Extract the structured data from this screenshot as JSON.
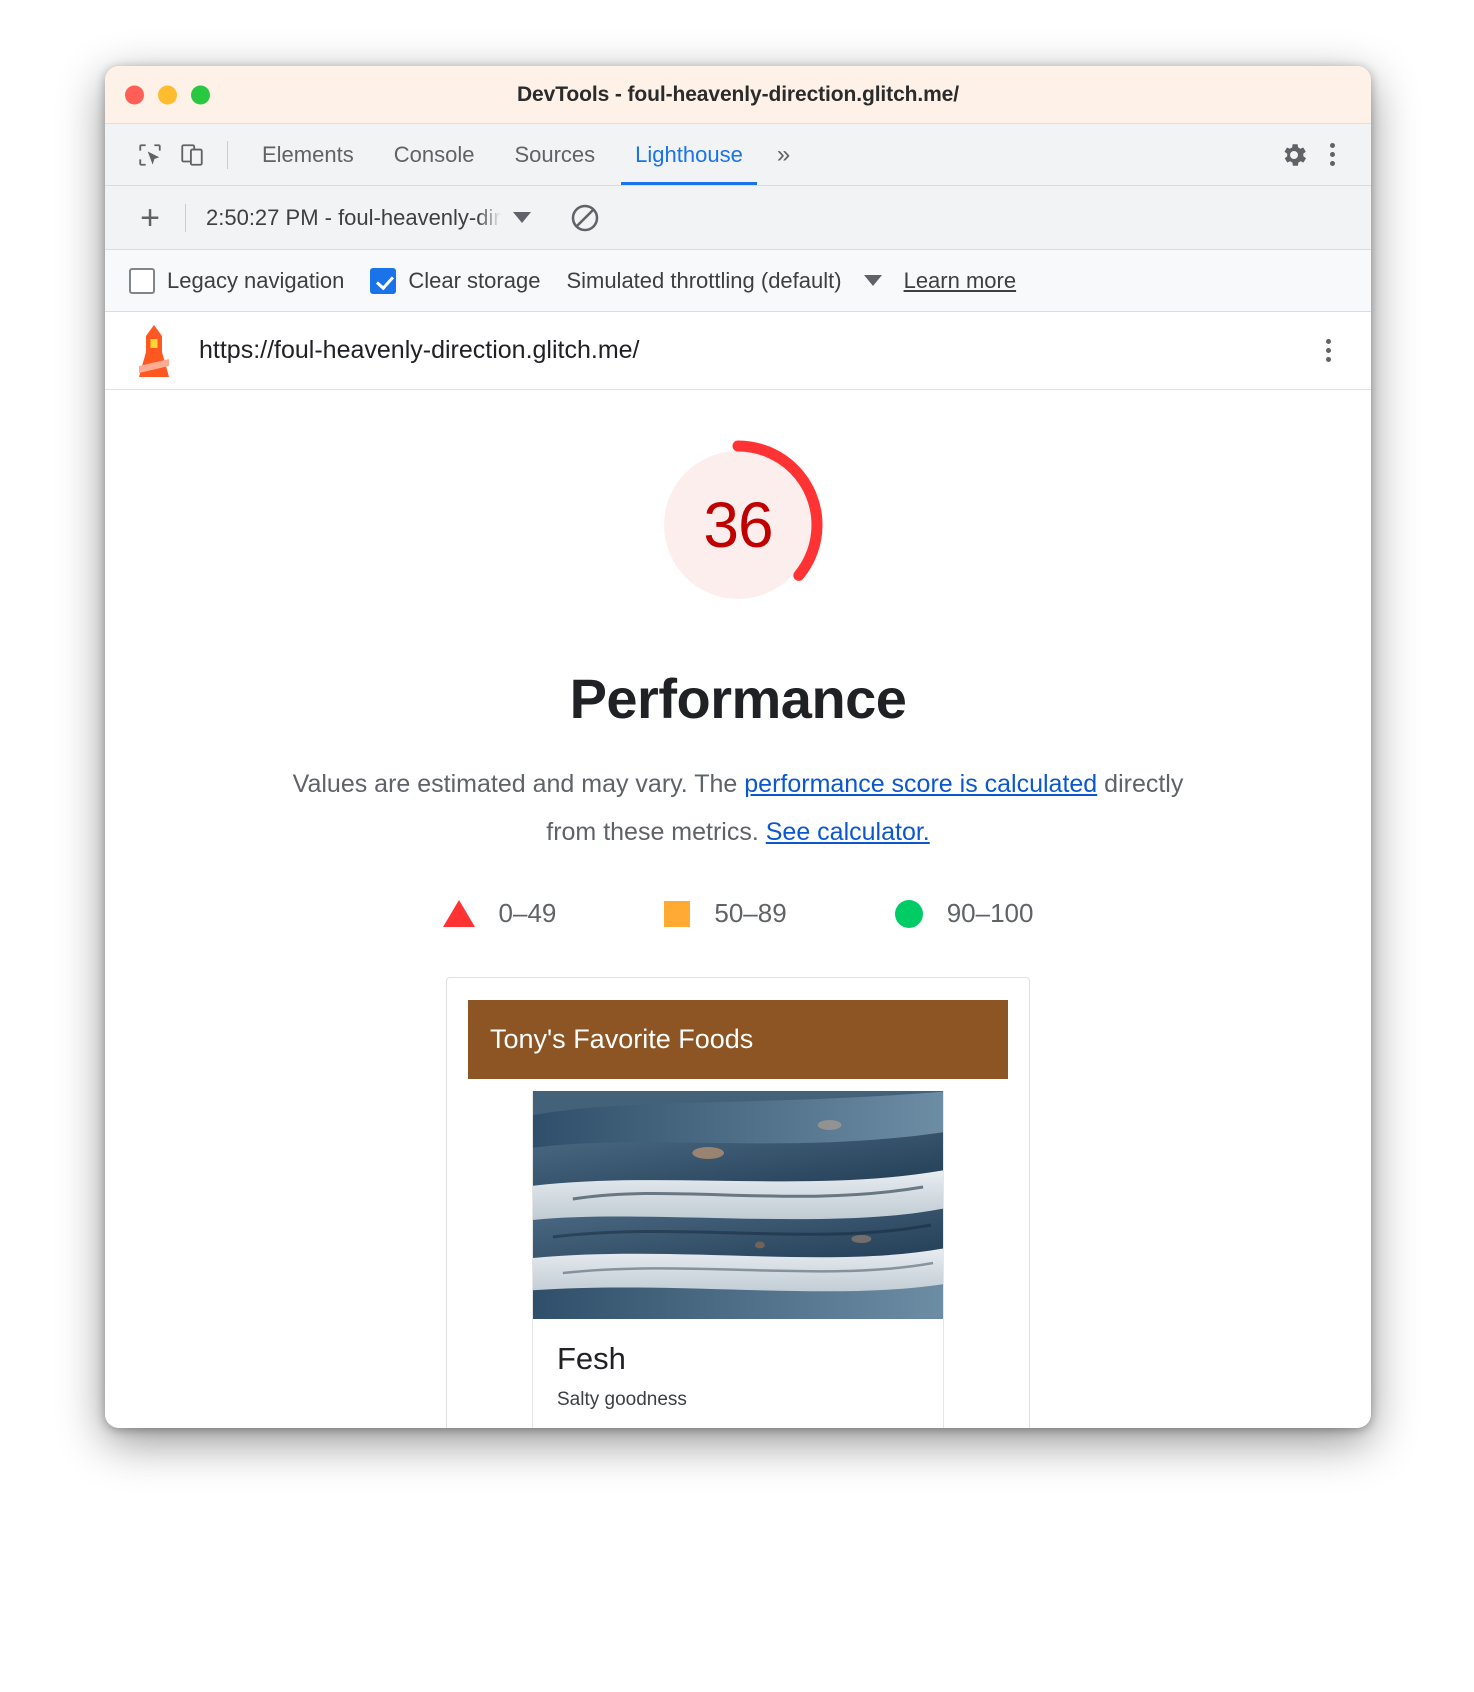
{
  "window": {
    "title": "DevTools - foul-heavenly-direction.glitch.me/"
  },
  "devtools_tabbar": {
    "inspect_icon": "inspect-cursor-icon",
    "device_icon": "device-toolbar-icon",
    "tabs": [
      {
        "label": "Elements",
        "active": false
      },
      {
        "label": "Console",
        "active": false
      },
      {
        "label": "Sources",
        "active": false
      },
      {
        "label": "Lighthouse",
        "active": true
      }
    ],
    "more_tabs": "»",
    "settings_icon": "gear-icon",
    "menu_icon": "more-vertical-icon"
  },
  "run_toolbar": {
    "add_label": "+",
    "selected_run": "2:50:27 PM - foul-heavenly-dir",
    "clear_icon": "clear-no-entry-icon"
  },
  "options": {
    "legacy_navigation": {
      "label": "Legacy navigation",
      "checked": false
    },
    "clear_storage": {
      "label": "Clear storage",
      "checked": true
    },
    "throttling": {
      "label": "Simulated throttling (default)"
    },
    "learn_more": "Learn more"
  },
  "report_header": {
    "logo": "lighthouse-icon",
    "url": "https://foul-heavenly-direction.glitch.me/",
    "menu_icon": "more-vertical-icon"
  },
  "report": {
    "score": "36",
    "score_value": 36,
    "category": "Performance",
    "description_part1": "Values are estimated and may vary. The ",
    "description_link1": "performance score is calculated",
    "description_part2": " directly from these metrics. ",
    "description_link2": "See calculator.",
    "legend": [
      {
        "marker": "triangle",
        "label": "0–49",
        "color": "#ff3333"
      },
      {
        "marker": "square",
        "label": "50–89",
        "color": "#ffaa33"
      },
      {
        "marker": "circle",
        "label": "90–100",
        "color": "#00cc66"
      }
    ]
  },
  "screenshot": {
    "site_header": "Tony's Favorite Foods",
    "card_title": "Fesh",
    "card_subtitle": "Salty goodness",
    "photo_alt": "fish-photo"
  },
  "colors": {
    "score_red": "#c00000",
    "gauge_arc": "#f33",
    "gauge_bg": "#fdeeee",
    "link_blue": "#0b57d0",
    "accent_blue": "#1a73e8",
    "site_header_brown": "#8d5524",
    "titlebar_bg": "#fdf1e8"
  }
}
